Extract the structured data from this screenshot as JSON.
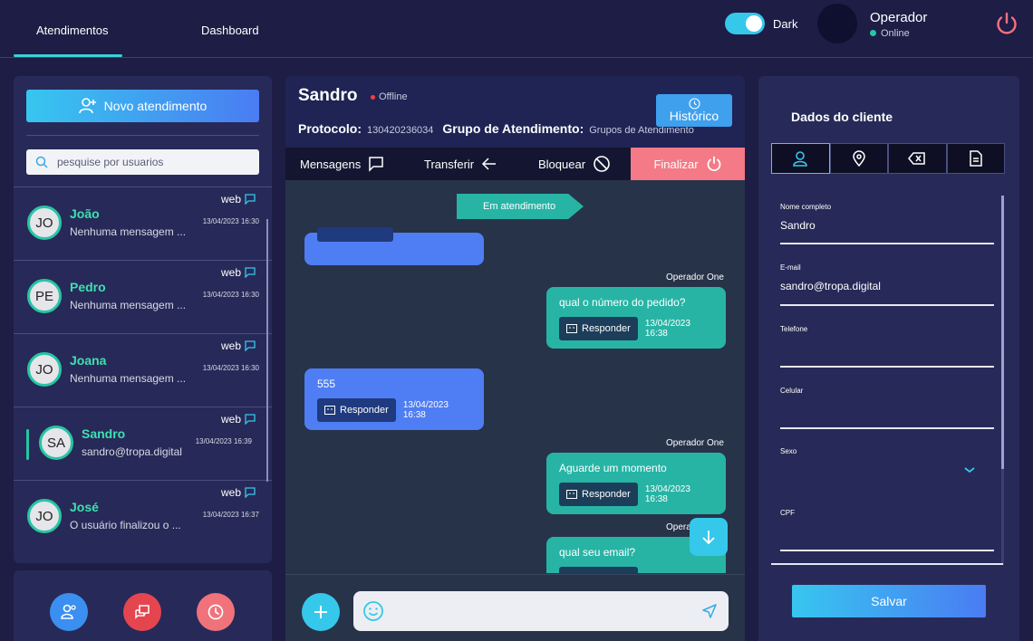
{
  "topbar": {
    "tabs": [
      {
        "label": "Atendimentos"
      },
      {
        "label": "Dashboard"
      }
    ],
    "theme_label": "Dark",
    "operator": {
      "name": "Operador",
      "status": "Online"
    }
  },
  "left": {
    "new_button": "Novo atendimento",
    "search_placeholder": "pesquise por usuarios",
    "contacts": [
      {
        "initials": "JO",
        "name": "João",
        "message": "Nenhuma mensagem ...",
        "date": "13/04/2023 16:30",
        "channel": "web"
      },
      {
        "initials": "PE",
        "name": "Pedro",
        "message": "Nenhuma mensagem ...",
        "date": "13/04/2023 16:30",
        "channel": "web"
      },
      {
        "initials": "JO",
        "name": "Joana",
        "message": "Nenhuma mensagem ...",
        "date": "13/04/2023 16:30",
        "channel": "web"
      },
      {
        "initials": "SA",
        "name": "Sandro",
        "message": "sandro@tropa.digital",
        "date": "13/04/2023 16:39",
        "channel": "web"
      },
      {
        "initials": "JO",
        "name": "José",
        "message": "O usuário finalizou o ...",
        "date": "13/04/2023 16:37",
        "channel": "web"
      }
    ]
  },
  "chat": {
    "name": "Sandro",
    "status": "Offline",
    "protocol_label": "Protocolo:",
    "protocol_value": "130420236034",
    "group_label": "Grupo de Atendimento:",
    "group_value": "Grupos de Atendimento",
    "history_button": "Histórico",
    "actions": {
      "messages": "Mensagens",
      "transfer": "Transferir",
      "block": "Bloquear",
      "finish": "Finalizar"
    },
    "status_flag": "Em atendimento",
    "reply_label": "Responder",
    "messages": [
      {
        "sender": "Operador One",
        "text": "qual o número do pedido?",
        "time": "13/04/2023 16:38"
      },
      {
        "sender": "",
        "text": "555",
        "time": "13/04/2023 16:38"
      },
      {
        "sender": "Operador One",
        "text": "Aguarde um momento",
        "time": "13/04/2023 16:38"
      },
      {
        "sender": "Operador One",
        "text": "qual seu email?",
        "time": ""
      }
    ]
  },
  "right": {
    "title": "Dados do cliente",
    "fields": [
      {
        "label": "Nome completo",
        "value": "Sandro"
      },
      {
        "label": "E-mail",
        "value": "sandro@tropa.digital"
      },
      {
        "label": "Telefone",
        "value": ""
      },
      {
        "label": "Celular",
        "value": ""
      },
      {
        "label": "Sexo",
        "value": ""
      },
      {
        "label": "CPF",
        "value": ""
      }
    ],
    "save_button": "Salvar"
  },
  "colors": {
    "accent": "#35c8ea",
    "green": "#27b4a5",
    "blue": "#4f7df3",
    "danger": "#f37a86",
    "background": "#1d1d45",
    "panel": "#272a58"
  }
}
